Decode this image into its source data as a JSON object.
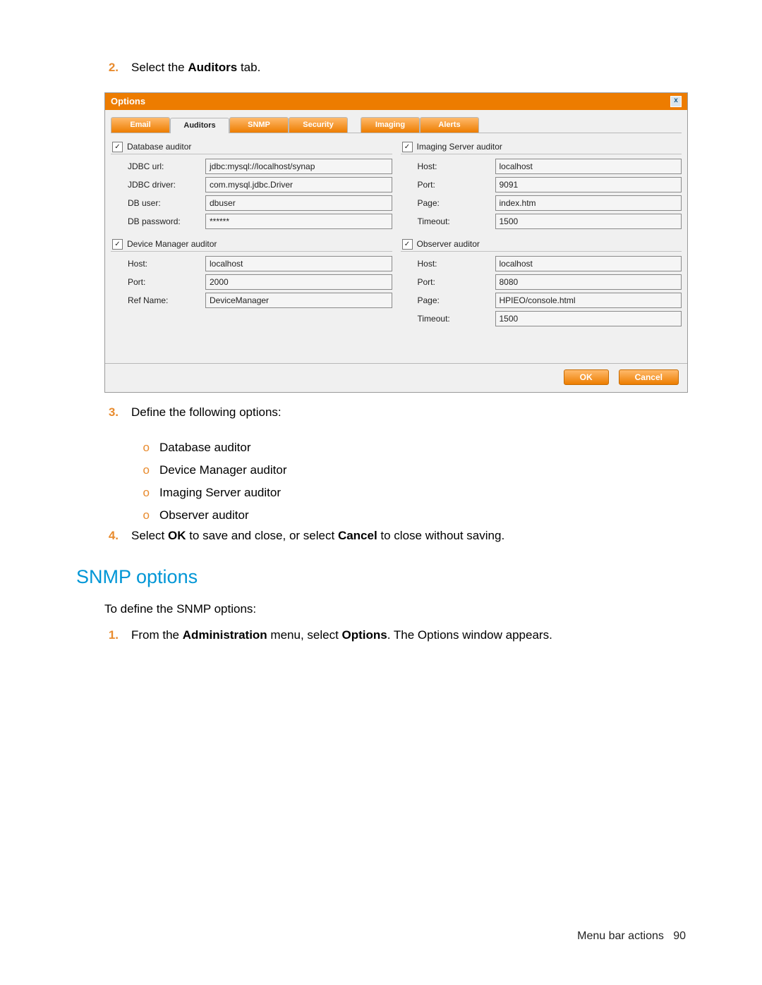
{
  "steps_top": [
    {
      "n": "2.",
      "text_pre": "Select the ",
      "bold": "Auditors",
      "text_post": " tab."
    }
  ],
  "window": {
    "title": "Options",
    "tabs_left": [
      "Email",
      "Auditors",
      "SNMP",
      "Security"
    ],
    "tabs_right": [
      "Imaging",
      "Alerts"
    ],
    "active_tab": "Auditors",
    "left_groups": [
      {
        "title": "Database auditor",
        "fields": [
          {
            "label": "JDBC url:",
            "value": "jdbc:mysql://localhost/synap"
          },
          {
            "label": "JDBC driver:",
            "value": "com.mysql.jdbc.Driver"
          },
          {
            "label": "DB user:",
            "value": "dbuser"
          },
          {
            "label": "DB password:",
            "value": "******"
          }
        ]
      },
      {
        "title": "Device Manager auditor",
        "fields": [
          {
            "label": "Host:",
            "value": "localhost"
          },
          {
            "label": "Port:",
            "value": "2000"
          },
          {
            "label": "Ref Name:",
            "value": "DeviceManager"
          }
        ]
      }
    ],
    "right_groups": [
      {
        "title": "Imaging Server auditor",
        "fields": [
          {
            "label": "Host:",
            "value": "localhost"
          },
          {
            "label": "Port:",
            "value": "9091"
          },
          {
            "label": "Page:",
            "value": "index.htm"
          },
          {
            "label": "Timeout:",
            "value": "1500"
          }
        ]
      },
      {
        "title": "Observer auditor",
        "fields": [
          {
            "label": "Host:",
            "value": "localhost"
          },
          {
            "label": "Port:",
            "value": "8080"
          },
          {
            "label": "Page:",
            "value": "HPIEO/console.html"
          },
          {
            "label": "Timeout:",
            "value": "1500"
          }
        ]
      }
    ],
    "buttons": {
      "ok": "OK",
      "cancel": "Cancel"
    }
  },
  "steps_mid": {
    "define_lead": "Define the following options:",
    "sub_items": [
      "Database auditor",
      "Device Manager auditor",
      "Imaging Server auditor",
      "Observer auditor"
    ],
    "step4_pre": "Select ",
    "step4_ok": "OK",
    "step4_mid": " to save and close, or select ",
    "step4_cancel": "Cancel",
    "step4_post": " to close without saving."
  },
  "section_heading": "SNMP options",
  "snmp": {
    "intro": "To define the SNMP options:",
    "step1_pre": "From the ",
    "step1_admin": "Administration",
    "step1_mid": " menu, select ",
    "step1_opt": "Options",
    "step1_post": ". The Options window appears."
  },
  "footer": {
    "text": "Menu bar actions",
    "page": "90"
  },
  "nums": {
    "n3": "3.",
    "n4": "4.",
    "n1": "1."
  },
  "circ": "o"
}
